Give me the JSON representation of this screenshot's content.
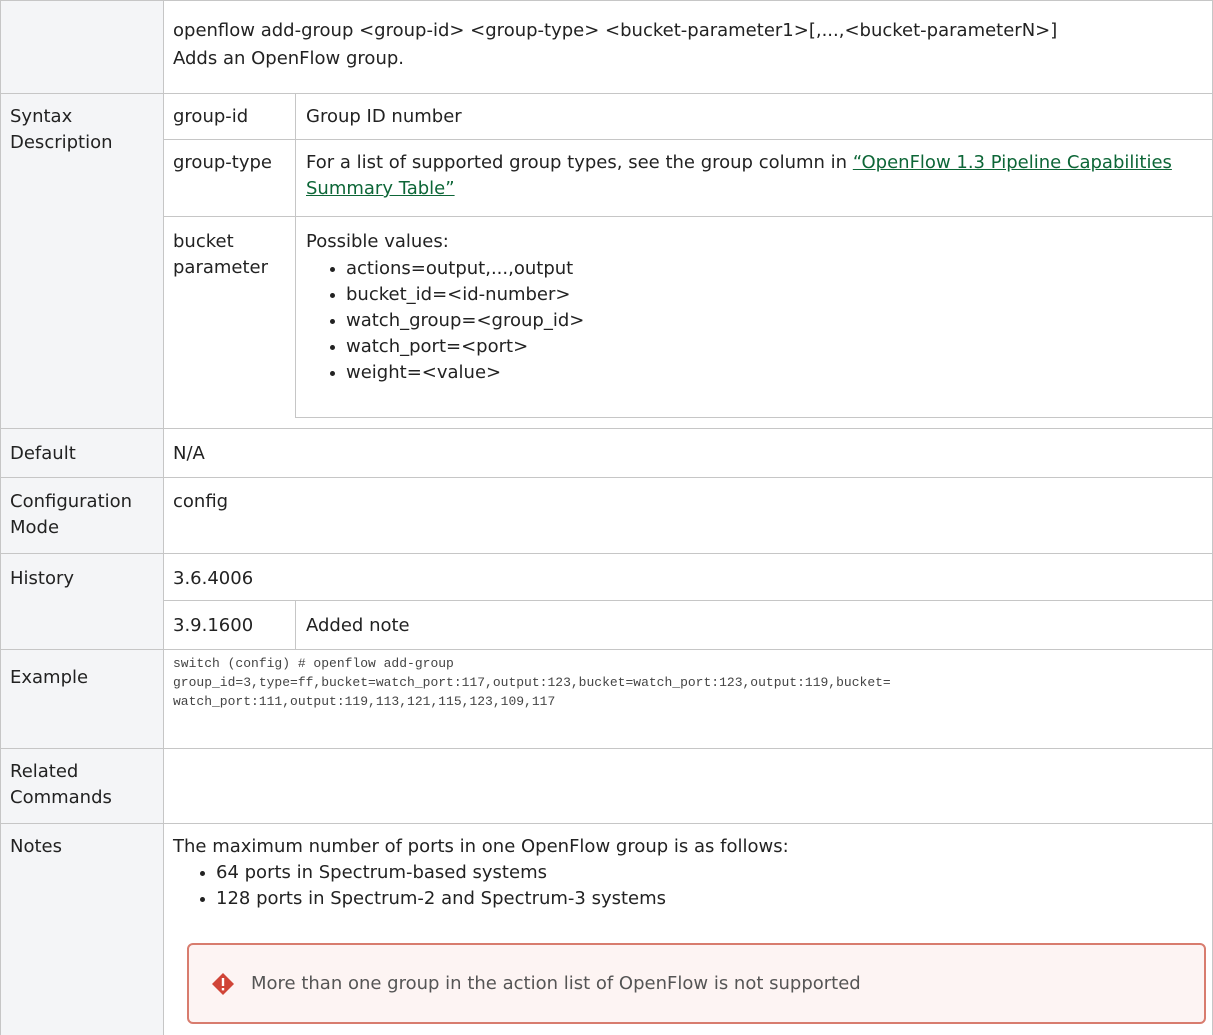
{
  "command": {
    "syntax": "openflow add-group <group-id> <group-type> <bucket-parameter1>[,...,<bucket-parameterN>]",
    "description": "Adds an OpenFlow group."
  },
  "syntax_description": {
    "label": "Syntax Description",
    "params": [
      {
        "name": "group-id",
        "desc": "Group ID number"
      },
      {
        "name": "group-type",
        "desc_prefix": "For a list of supported group types, see the group column in ",
        "link_text": "“OpenFlow 1.3 Pipeline Capabilities Summary Table”"
      },
      {
        "name": "bucket parameter",
        "desc": "Possible values:",
        "values": [
          "actions=output,...,output",
          "bucket_id=<id-number>",
          "watch_group=<group_id>",
          "watch_port=<port>",
          "weight=<value>"
        ]
      }
    ]
  },
  "default": {
    "label": "Default",
    "value": "N/A"
  },
  "config_mode": {
    "label": "Configuration Mode",
    "value": "config"
  },
  "history": {
    "label": "History",
    "entries": [
      {
        "version": "3.6.4006",
        "note": ""
      },
      {
        "version": "3.9.1600",
        "note": "Added note"
      }
    ]
  },
  "example": {
    "label": "Example",
    "lines": [
      "switch (config) # openflow add-group",
      "group_id=3,type=ff,bucket=watch_port:117,output:123,bucket=watch_port:123,output:119,bucket=",
      "watch_port:111,output:119,113,121,115,123,109,117"
    ]
  },
  "related": {
    "label": "Related Commands",
    "value": ""
  },
  "notes": {
    "label": "Notes",
    "intro": "The maximum number of ports in one OpenFlow group is as follows:",
    "items": [
      "64 ports in Spectrum-based systems",
      "128 ports in Spectrum-2 and Spectrum-3 systems"
    ],
    "warning": "More than one group in the action list of OpenFlow is not supported"
  },
  "colors": {
    "link": "#0d6637",
    "border": "#c6c6c6",
    "warning_border": "#d87c6e",
    "warning_bg": "#fdf4f3",
    "warning_icon": "#d04437"
  }
}
